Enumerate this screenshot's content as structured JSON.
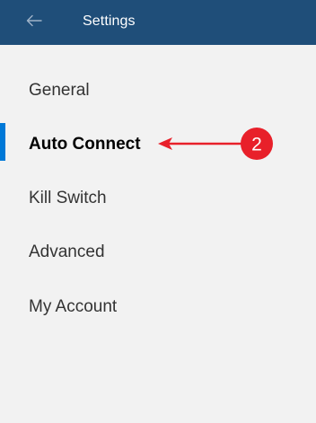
{
  "header": {
    "back_icon": "back-arrow-icon",
    "title": "Settings",
    "background_color": "#1f4e79"
  },
  "nav": {
    "items": [
      {
        "label": "General",
        "selected": false
      },
      {
        "label": "Auto Connect",
        "selected": true
      },
      {
        "label": "Kill Switch",
        "selected": false
      },
      {
        "label": "Advanced",
        "selected": false
      },
      {
        "label": "My Account",
        "selected": false
      }
    ],
    "selection_color": "#0078d7"
  },
  "annotation": {
    "number": "2",
    "color": "#e8202a"
  }
}
